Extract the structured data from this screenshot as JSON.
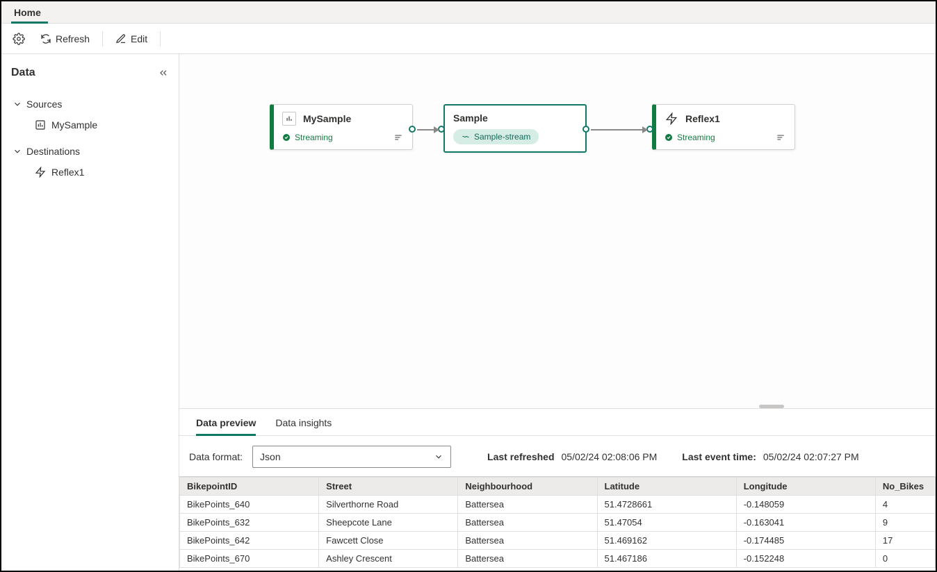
{
  "tabs": {
    "home": "Home"
  },
  "toolbar": {
    "refresh": "Refresh",
    "edit": "Edit"
  },
  "sidebar": {
    "title": "Data",
    "sources_label": "Sources",
    "destinations_label": "Destinations",
    "sources": [
      {
        "label": "MySample"
      }
    ],
    "destinations": [
      {
        "label": "Reflex1"
      }
    ]
  },
  "nodes": {
    "source": {
      "title": "MySample",
      "status": "Streaming"
    },
    "stream": {
      "title": "Sample",
      "chip": "Sample-stream"
    },
    "dest": {
      "title": "Reflex1",
      "status": "Streaming"
    }
  },
  "bottom": {
    "tab_preview": "Data preview",
    "tab_insights": "Data insights",
    "format_label": "Data format:",
    "format_value": "Json",
    "last_refreshed_label": "Last refreshed",
    "last_refreshed_value": "05/02/24 02:08:06 PM",
    "last_event_label": "Last event time:",
    "last_event_value": "05/02/24 02:07:27 PM",
    "columns": [
      "BikepointID",
      "Street",
      "Neighbourhood",
      "Latitude",
      "Longitude",
      "No_Bikes"
    ],
    "rows": [
      [
        "BikePoints_640",
        "Silverthorne Road",
        "Battersea",
        "51.4728661",
        "-0.148059",
        "4"
      ],
      [
        "BikePoints_632",
        "Sheepcote Lane",
        "Battersea",
        "51.47054",
        "-0.163041",
        "9"
      ],
      [
        "BikePoints_642",
        "Fawcett Close",
        "Battersea",
        "51.469162",
        "-0.174485",
        "17"
      ],
      [
        "BikePoints_670",
        "Ashley Crescent",
        "Battersea",
        "51.467186",
        "-0.152248",
        "0"
      ]
    ]
  }
}
